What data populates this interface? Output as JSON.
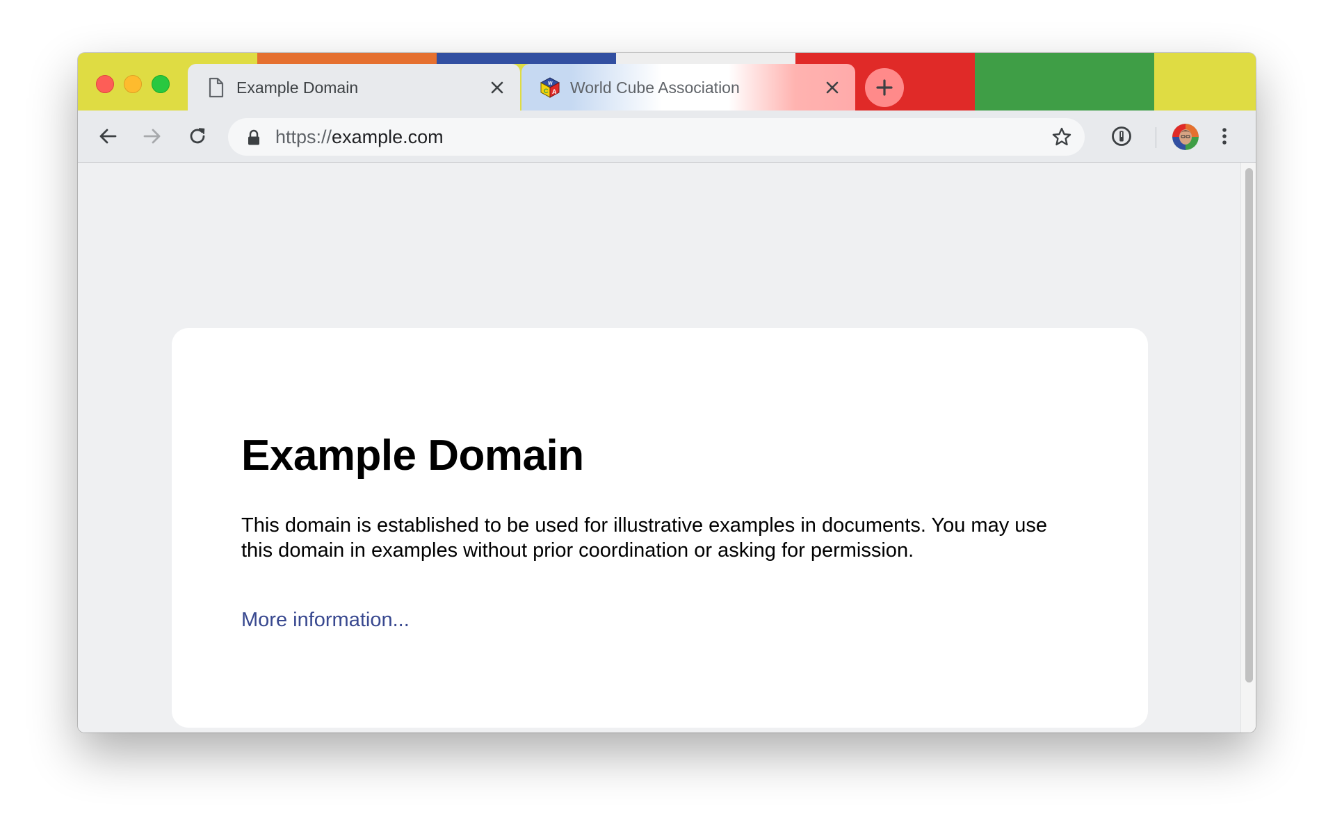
{
  "window": {
    "stripe_colors": [
      "#dfdc43",
      "#e5702f",
      "#324fa1",
      "#eeeeee",
      "#e02a28",
      "#e02a28",
      "#3f9e46",
      "#dfdc43"
    ],
    "traffic_lights": {
      "close": "#fd5e57",
      "minimize": "#febb2e",
      "zoom": "#29c840"
    }
  },
  "tabs": [
    {
      "title": "Example Domain",
      "icon": "page-icon",
      "active": true
    },
    {
      "title": "World Cube Association",
      "icon": "wca-logo-icon",
      "active": false
    }
  ],
  "toolbar": {
    "url_scheme": "https://",
    "url_host": "example.com",
    "icons": [
      "back-icon",
      "forward-icon",
      "reload-icon",
      "lock-icon",
      "star-icon",
      "password-manager-icon",
      "profile-avatar",
      "menu-icon"
    ]
  },
  "page": {
    "heading": "Example Domain",
    "body": "This domain is established to be used for illustrative examples in documents. You may use this domain in examples without prior coordination or asking for permission.",
    "link": "More information..."
  }
}
